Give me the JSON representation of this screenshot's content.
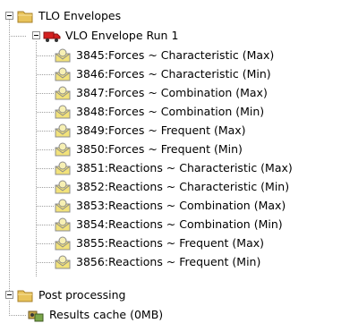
{
  "tree": {
    "root": {
      "label": "TLO Envelopes",
      "icon": "folder-icon",
      "children": [
        {
          "label": "VLO Envelope Run 1",
          "icon": "truck-icon",
          "items": [
            "3845:Forces ~ Characteristic (Max)",
            "3846:Forces ~ Characteristic (Min)",
            "3847:Forces ~ Combination (Max)",
            "3848:Forces ~ Combination (Min)",
            "3849:Forces ~ Frequent (Max)",
            "3850:Forces ~ Frequent (Min)",
            "3851:Reactions ~ Characteristic (Max)",
            "3852:Reactions ~ Characteristic (Min)",
            "3853:Reactions ~ Combination (Max)",
            "3854:Reactions ~ Combination (Min)",
            "3855:Reactions ~ Frequent (Max)",
            "3856:Reactions ~ Frequent (Min)"
          ],
          "item_icon": "envelope-result-icon"
        }
      ]
    },
    "post": {
      "label": "Post processing",
      "icon": "folder-icon",
      "children": [
        {
          "label": "Results cache (0MB)",
          "icon": "cache-icon"
        }
      ]
    }
  },
  "colors": {
    "folder": "#e8c35a",
    "folder_dark": "#a8822a",
    "truck": "#d42020",
    "envelope_item": "#f2e27a",
    "tree_line": "#a0a0a0"
  }
}
